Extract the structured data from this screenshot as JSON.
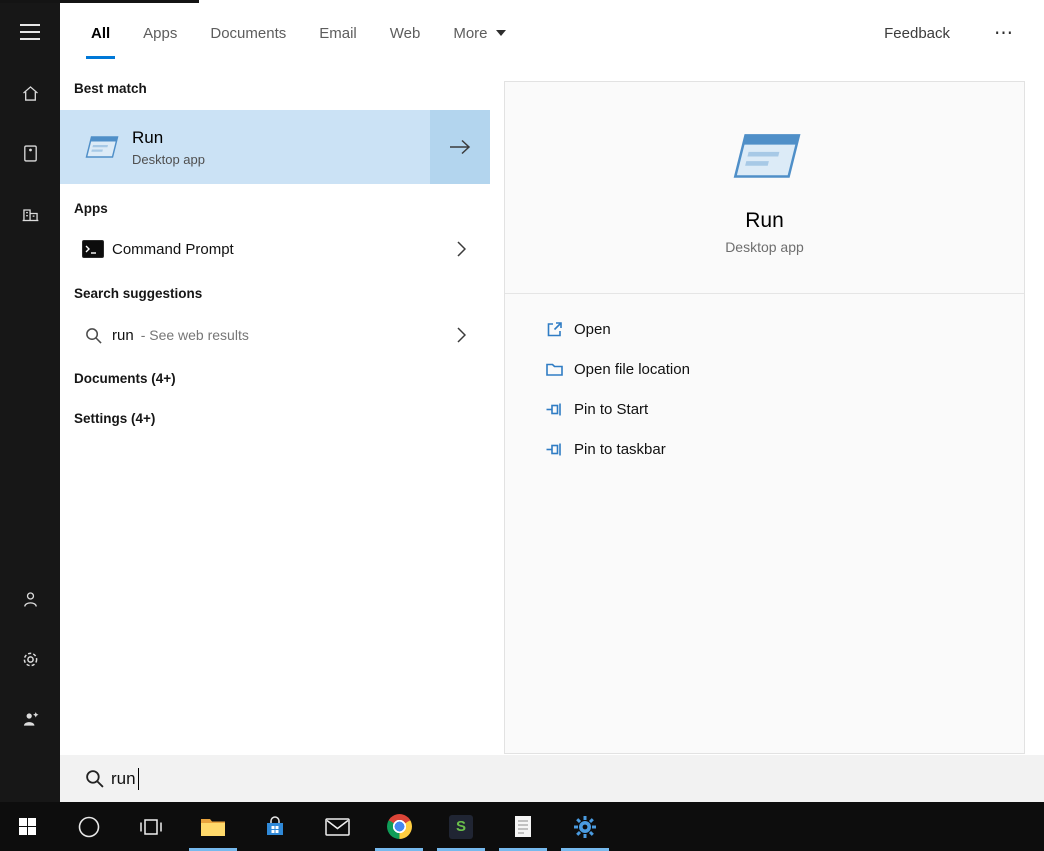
{
  "tabbar": {
    "tabs": [
      {
        "label": "All"
      },
      {
        "label": "Apps"
      },
      {
        "label": "Documents"
      },
      {
        "label": "Email"
      },
      {
        "label": "Web"
      },
      {
        "label": "More"
      }
    ],
    "active_tab": "All",
    "feedback": "Feedback",
    "overflow": "⋯"
  },
  "results": {
    "best_match_header": "Best match",
    "best_match": {
      "title": "Run",
      "subtitle": "Desktop app"
    },
    "apps_header": "Apps",
    "apps": [
      {
        "label": "Command Prompt"
      }
    ],
    "suggestions_header": "Search suggestions",
    "suggestions": [
      {
        "query": "run",
        "hint": "- See web results"
      }
    ],
    "documents_header": "Documents (4+)",
    "settings_header": "Settings (4+)"
  },
  "preview": {
    "title": "Run",
    "subtitle": "Desktop app",
    "actions": [
      {
        "label": "Open"
      },
      {
        "label": "Open file location"
      },
      {
        "label": "Pin to Start"
      },
      {
        "label": "Pin to taskbar"
      }
    ]
  },
  "searchbox": {
    "value": "run"
  },
  "taskbar": {
    "s_app_letter": "S"
  },
  "colors": {
    "accent": "#0078d7",
    "selection": "#cbe2f5",
    "selection_arrow": "#b3d5ee",
    "taskbar_indicator": "#76b9ed",
    "rail": "#171717",
    "taskbar_bg": "#0d0d0d"
  }
}
